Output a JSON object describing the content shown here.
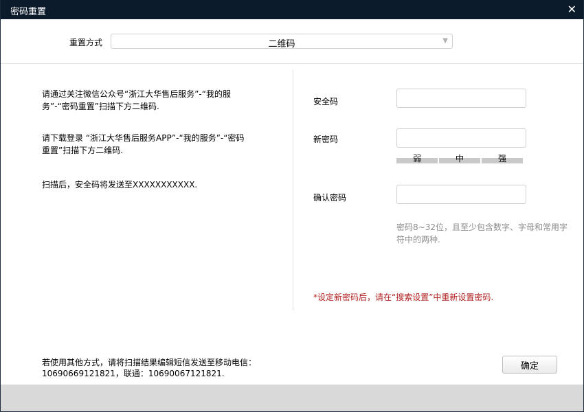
{
  "window": {
    "title": "密码重置",
    "close": "✕"
  },
  "reset_method": {
    "label": "重置方式",
    "value": "二维码"
  },
  "instructions": {
    "p1": "请通过关注微信公众号“浙江大华售后服务”-“我的服务”-“密码重置”扫描下方二维码.",
    "p2": "请下载登录 “浙江大华售后服务APP”-“我的服务”-“密码重置”扫描下方二维码.",
    "p3": "扫描后，安全码将发送至XXXXXXXXXXX."
  },
  "form": {
    "security_code_label": "安全码",
    "new_password_label": "新密码",
    "confirm_password_label": "确认密码",
    "strength": {
      "weak": "弱",
      "medium": "中",
      "strong": "强"
    },
    "hint": "密码8~32位，且至少包含数字、字母和常用字符中的两种.",
    "note": "*设定新密码后，请在“搜索设置”中重新设置密码."
  },
  "bottom": {
    "text": "若使用其他方式，请将扫描结果编辑短信发送至移动电信：10690669121821，联通：10690067121821.",
    "confirm_button": "确定"
  },
  "colors": {
    "titlebar": "#0b1b2b",
    "note_red": "#b21e1e",
    "hint_gray": "#8b8b8b",
    "footer_gray": "#d9d9d9"
  }
}
